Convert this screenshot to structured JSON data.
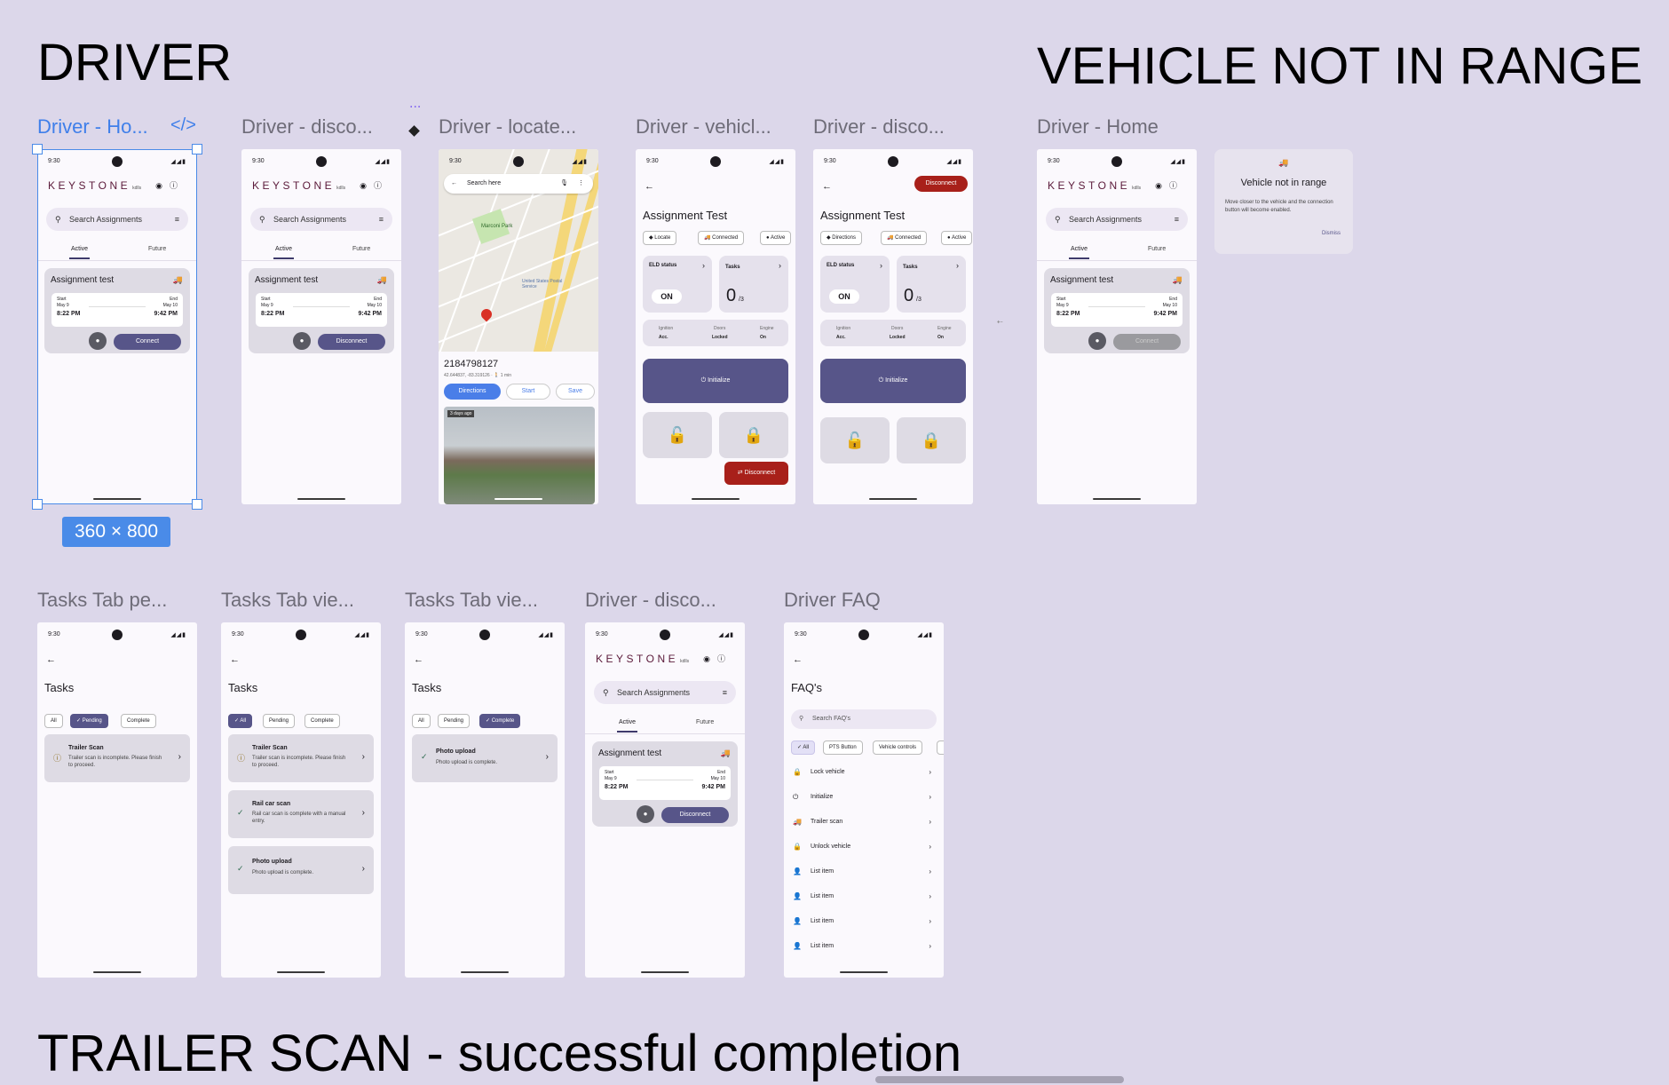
{
  "sections": {
    "driver": "DRIVER",
    "vehicle_not_in_range": "VEHICLE NOT IN RANGE",
    "trailer_scan": "TRAILER SCAN - successful completion"
  },
  "frame_labels": {
    "f1": "Driver - Ho...",
    "f2": "Driver - disco...",
    "f3": "Driver - locate...",
    "f4": "Driver - vehicl...",
    "f5": "Driver - disco...",
    "f6": "Driver - Home",
    "f7": "Tasks Tab pe...",
    "f8": "Tasks Tab vie...",
    "f9": "Tasks Tab vie...",
    "f10": "Driver - disco...",
    "f11": "Driver FAQ"
  },
  "selection": {
    "size": "360 × 800",
    "code_icon": "</>",
    "dots": "..."
  },
  "status": {
    "time": "9:30",
    "icons": "◢◢▮"
  },
  "home": {
    "logo": "KEYSTONE",
    "logo_sub": "kdlls",
    "search_placeholder": "Search Assignments",
    "tab_active": "Active",
    "tab_future": "Future",
    "card_title": "Assignment test",
    "start_label": "Start",
    "end_label": "End",
    "start_date": "May 9",
    "end_date": "May 10",
    "start_time": "8:22 PM",
    "end_time": "9:42 PM",
    "connect": "Connect",
    "disconnect": "Disconnect"
  },
  "map": {
    "search": "Search here",
    "place_park": "Marconi Park",
    "place_post": "United States Postal Service",
    "address": "2184798127",
    "coords": "42.644837, -83.319126 · 🚶 1 min",
    "directions": "Directions",
    "start": "Start",
    "save": "Save",
    "photo_age": "3 days ago"
  },
  "vehicle": {
    "title": "Assignment Test",
    "chip_locate": "Locate",
    "chip_directions": "Directions",
    "chip_connected": "Connected",
    "chip_active": "Active",
    "eld_status": "ELD status",
    "eld_value": "ON",
    "tasks": "Tasks",
    "tasks_value": "0",
    "tasks_total": "/3",
    "ignition": "Ignition",
    "ignition_val": "Acc.",
    "doors": "Doors",
    "doors_val": "Locked",
    "engine": "Engine",
    "engine_val": "On",
    "initialize": "Initialize",
    "disconnect": "Disconnect"
  },
  "not_in_range": {
    "title": "Vehicle not in range",
    "body": "Move closer to the vehicle and the connection button will become enabled.",
    "dismiss": "Dismiss"
  },
  "tasks": {
    "title": "Tasks",
    "chip_all": "All",
    "chip_pending": "Pending",
    "chip_complete": "Complete",
    "trailer_title": "Trailer Scan",
    "trailer_desc": "Trailer scan is incomplete. Please finish to proceed.",
    "rail_title": "Rail car scan",
    "rail_desc": "Rail car scan is complete with a manual entry.",
    "photo_title": "Photo upload",
    "photo_desc": "Photo upload is complete."
  },
  "faq": {
    "title": "FAQ's",
    "search": "Search FAQ's",
    "chip_all": "All",
    "chip_pts": "PTS Button",
    "chip_vehicle": "Vehicle controls",
    "items": [
      "Lock vehicle",
      "Initialize",
      "Trailer scan",
      "Unlock vehicle",
      "List item",
      "List item",
      "List item",
      "List item"
    ]
  }
}
